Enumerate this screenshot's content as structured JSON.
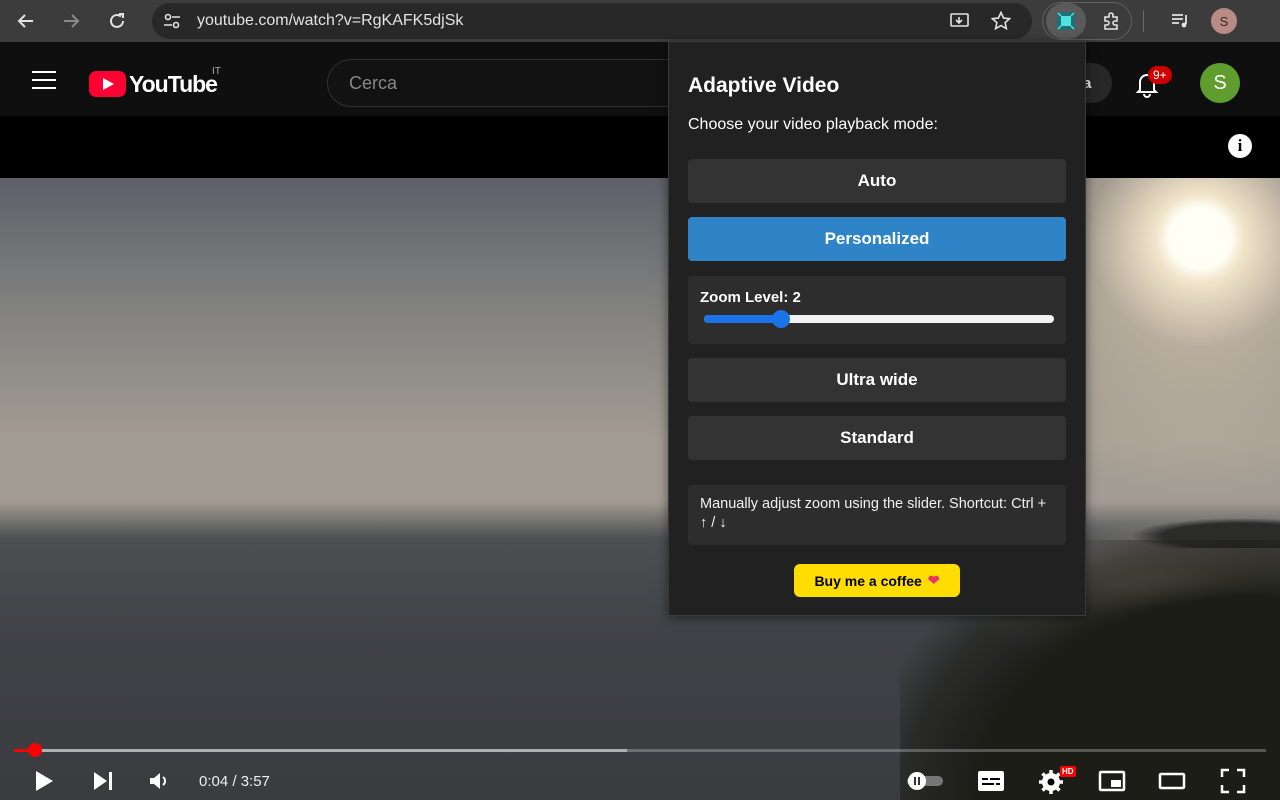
{
  "browser": {
    "url": "youtube.com/watch?v=RgKAFK5djSk",
    "profile_initial": "S",
    "icons": [
      "back-arrow-icon",
      "forward-arrow-icon",
      "reload-icon",
      "site-settings-icon",
      "install-app-icon",
      "bookmark-star-icon",
      "adaptive-video-extension-icon",
      "extensions-puzzle-icon",
      "media-control-icon"
    ]
  },
  "youtube": {
    "logo_text": "YouTube",
    "country_code": "IT",
    "search_placeholder": "Cerca",
    "header_partial_label": "a",
    "notifications_badge": "9+",
    "avatar_initial": "S",
    "brand_color": "#ff0033"
  },
  "player": {
    "current_time": "0:04",
    "duration": "3:57",
    "time_display": "0:04 / 3:57",
    "progress_fraction": 0.0169,
    "buffered_fraction": 0.49,
    "hd_badge": "HD",
    "autoplay": "paused",
    "controls": [
      "play-icon",
      "next-icon",
      "volume-icon",
      "autoplay-toggle",
      "subtitles-icon",
      "settings-gear-icon",
      "miniplayer-icon",
      "theater-mode-icon",
      "fullscreen-icon"
    ]
  },
  "popup": {
    "title": "Adaptive Video",
    "subtitle": "Choose your video playback mode:",
    "modes": [
      {
        "label": "Auto",
        "active": false
      },
      {
        "label": "Personalized",
        "active": true
      },
      {
        "label": "Ultra wide",
        "active": false
      },
      {
        "label": "Standard",
        "active": false
      }
    ],
    "zoom_label": "Zoom Level: 2",
    "zoom_value": 2,
    "zoom_slider_fraction": 0.22,
    "help_text": "Manually adjust zoom using the slider. Shortcut: Ctrl + ↑ / ↓",
    "coffee_label": "Buy me a coffee",
    "coffee_heart": "❤",
    "accent_color": "#2e84c6",
    "coffee_color": "#ffdd00"
  }
}
